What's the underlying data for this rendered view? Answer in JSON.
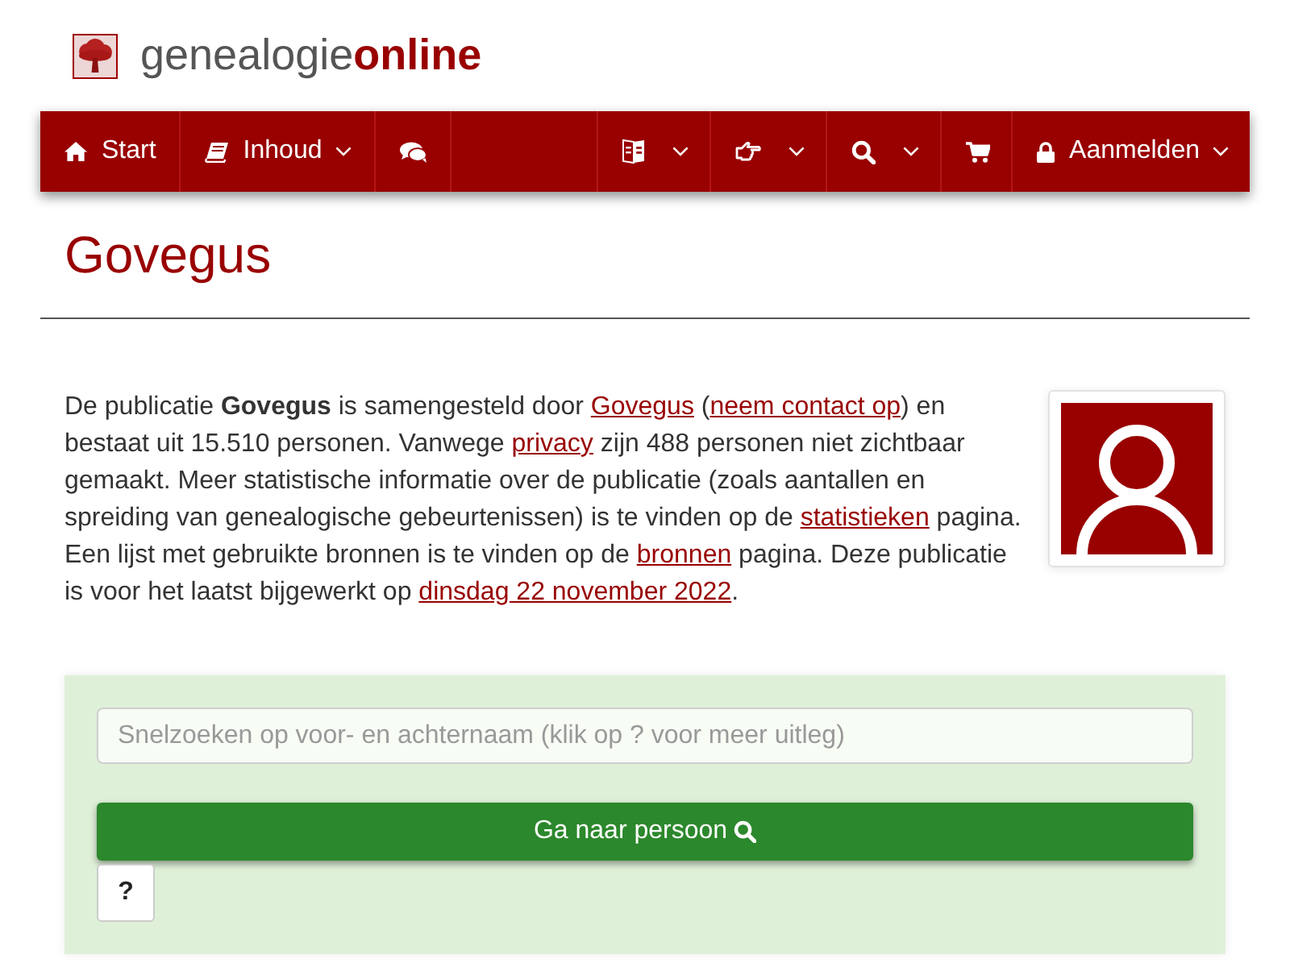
{
  "logo": {
    "text_regular": "genealogie",
    "text_bold": "online"
  },
  "navbar": {
    "left": [
      {
        "label": "Start",
        "dropdown": false
      },
      {
        "label": "Inhoud",
        "dropdown": true
      },
      {
        "dropdown": false
      }
    ],
    "right": [
      {
        "dropdown": true
      },
      {
        "dropdown": true
      },
      {
        "dropdown": true
      },
      {
        "dropdown": false
      },
      {
        "label": "Aanmelden",
        "dropdown": true
      }
    ]
  },
  "page_title": "Govegus",
  "description": [
    {
      "kind": "text",
      "text": "De publicatie **Govegus** is samengesteld door "
    },
    {
      "kind": "link",
      "text": "Govegus"
    },
    {
      "kind": "text",
      "text": " ("
    },
    {
      "kind": "link",
      "text": "neem contact op"
    },
    {
      "kind": "text",
      "text": ") en bestaat uit 15.510 personen. Vanwege "
    },
    {
      "kind": "link",
      "text": "privacy"
    },
    {
      "kind": "text",
      "text": " zijn 488 personen niet zichtbaar gemaakt. Meer statistische informatie over de publicatie (zoals aantallen en spreiding van genealogische gebeurtenissen) is te vinden op de "
    },
    {
      "kind": "link",
      "text": "statistieken"
    },
    {
      "kind": "text",
      "text": " pagina. Een lijst met gebruikte bronnen is te vinden op de "
    },
    {
      "kind": "link",
      "text": "bronnen"
    },
    {
      "kind": "text",
      "text": " pagina. Deze publicatie is voor het laatst bijgewerkt op "
    },
    {
      "kind": "link",
      "text": "dinsdag 22 november 2022"
    },
    {
      "kind": "text",
      "text": "."
    }
  ],
  "search": {
    "placeholder": "Snelzoeken op voor- en achternaam (klik op ? voor meer uitleg)",
    "submit_button": "Ga naar persoon",
    "help_button": "?"
  }
}
